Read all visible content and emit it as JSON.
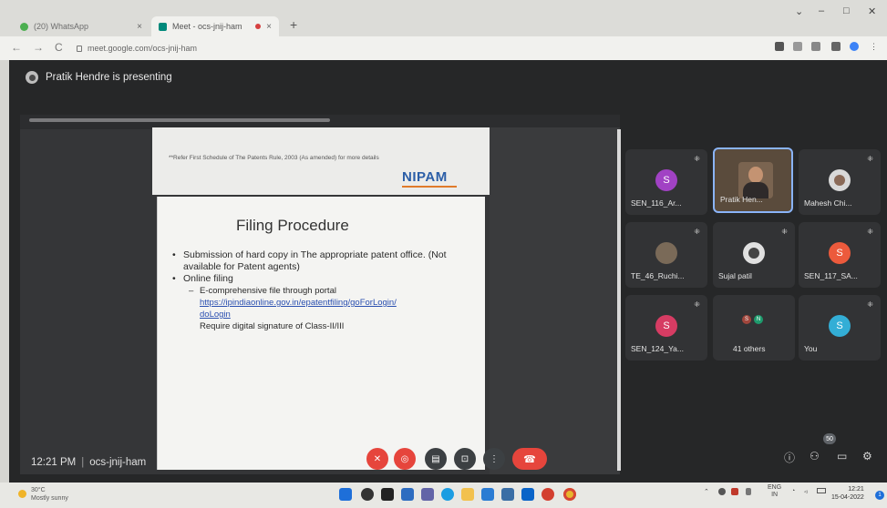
{
  "browser": {
    "tabs": [
      {
        "title": "(20) WhatsApp"
      },
      {
        "title": "Meet - ocs-jnij-ham"
      }
    ],
    "url": "meet.google.com/ocs-jnij-ham",
    "new_tab": "+",
    "tab_close": "×",
    "window_controls": {
      "minimize": "–",
      "maximize": "□",
      "close": "✕",
      "dropdown": "⌄"
    },
    "nav": {
      "back": "←",
      "forward": "→",
      "reload": "C"
    }
  },
  "meet": {
    "presenting_text": "Pratik Hendre is presenting",
    "meeting_time": "12:21 PM",
    "meeting_code": "ocs-jnij-ham",
    "participant_badge": "50",
    "participants": [
      {
        "name": "SEN_116_Ar...",
        "initial": "S",
        "color": "#a142c4"
      },
      {
        "name": "Pratik Hen...",
        "initial": "",
        "color": "#5a4b3c"
      },
      {
        "name": "Mahesh Chi...",
        "initial": "",
        "color": "#c0c0c0"
      },
      {
        "name": "TE_46_Ruchi...",
        "initial": "",
        "color": "#7a6a58"
      },
      {
        "name": "Sujal patil",
        "initial": "",
        "color": "#d8d8d8"
      },
      {
        "name": "SEN_117_SA...",
        "initial": "S",
        "color": "#ec5a3c"
      },
      {
        "name": "SEN_124_Ya...",
        "initial": "S",
        "color": "#d63c63"
      },
      {
        "name": "41 others",
        "initial": "",
        "color": "#3c4043"
      },
      {
        "name": "You",
        "initial": "S",
        "color": "#33aed6"
      }
    ],
    "others_avatars": [
      "S",
      "N"
    ]
  },
  "slide": {
    "footnote": "**Refer First Schedule of The Patents Rule, 2003 (As amended) for more details",
    "logo": "NIPAM",
    "title": "Filing Procedure",
    "bullet1": "Submission of hard copy in The appropriate patent office. (Not available for Patent agents)",
    "bullet2": "Online filing",
    "sub1": "E-comprehensive file through portal",
    "link_line1": "https://ipindiaonline.gov.in/epatentfiling/goForLogin/",
    "link_line2": "doLogin",
    "sub2": "Require digital signature of Class-II/III"
  },
  "taskbar": {
    "weather_temp": "30°C",
    "weather_text": "Mostly sunny",
    "lang": "ENG",
    "lang_region": "IN",
    "clock_time": "12:21",
    "clock_date": "15-04-2022",
    "notif": "1"
  },
  "colors": {
    "meet_bg": "#262728",
    "end_call": "#e6453c",
    "accent_blue": "#8ab4f8",
    "nipam_blue": "#2b5ea7"
  }
}
